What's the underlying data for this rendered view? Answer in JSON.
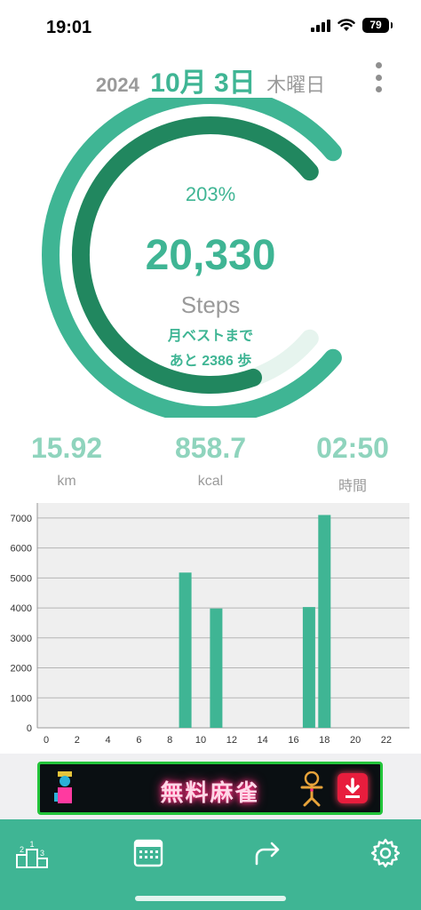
{
  "status_bar": {
    "time": "19:01",
    "battery": "79",
    "icons": [
      "cellular-signal-icon",
      "wifi-icon",
      "battery-icon"
    ]
  },
  "header": {
    "year": "2024",
    "month_day": "10月 3日",
    "weekday": "木曜日",
    "menu_icon": "more-vertical-icon"
  },
  "gauge": {
    "percent_text": "203%",
    "steps": "20,330",
    "unit": "Steps",
    "message_line1": "月ベストまで",
    "message_line2": "あと 2386 歩",
    "progress_fraction": 0.89
  },
  "metrics": [
    {
      "value": "15.92",
      "label": "km"
    },
    {
      "value": "858.7",
      "label": "kcal"
    },
    {
      "value": "02:50",
      "label": "時間"
    }
  ],
  "chart_data": {
    "type": "bar",
    "x": [
      9,
      11,
      17,
      18
    ],
    "values": [
      5180,
      3980,
      4030,
      7100
    ],
    "xlim": [
      0,
      23.5
    ],
    "ylim": [
      0,
      7500
    ],
    "x_ticks": [
      "0",
      "2",
      "4",
      "6",
      "8",
      "10",
      "12",
      "14",
      "16",
      "18",
      "20",
      "22"
    ],
    "y_ticks": [
      "0",
      "1000",
      "2000",
      "3000",
      "4000",
      "5000",
      "6000",
      "7000"
    ],
    "grid": true,
    "bar_color": "#3fb594"
  },
  "ad": {
    "text": "無料麻雀"
  },
  "tab_bar": {
    "tabs": [
      {
        "name": "ranking",
        "icon": "podium-icon"
      },
      {
        "name": "calendar",
        "icon": "calendar-icon"
      },
      {
        "name": "share",
        "icon": "share-arrow-icon"
      },
      {
        "name": "settings",
        "icon": "gear-icon"
      }
    ]
  },
  "colors": {
    "accent": "#3fb594",
    "accent_dark": "#21875f",
    "metric_value": "#8fd4bd",
    "muted_text": "#9a9a9a",
    "tab_bar": "#3fb594"
  }
}
